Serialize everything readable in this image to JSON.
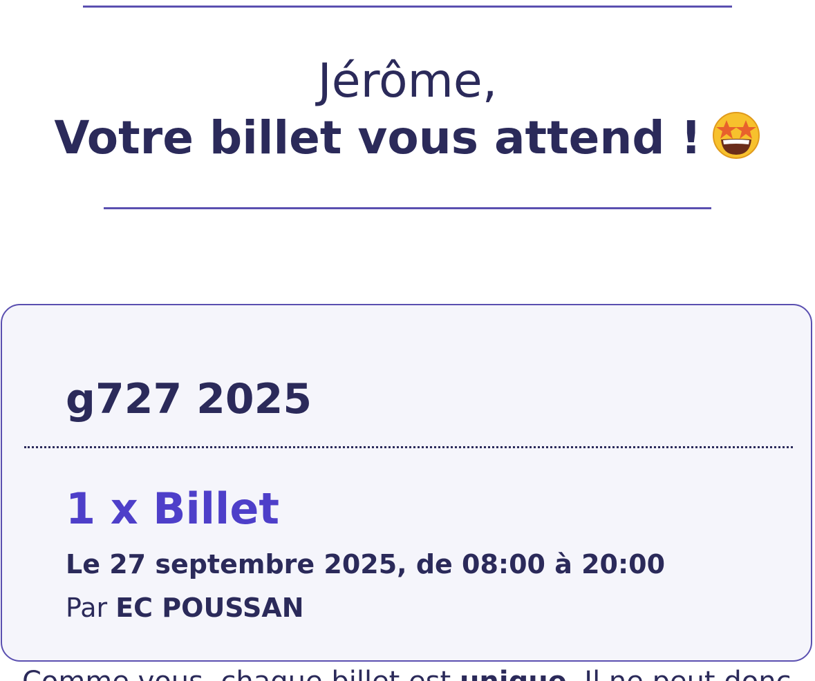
{
  "header": {
    "greeting": "Jérôme,",
    "headline": "Votre billet vous attend !",
    "emoji_icon": "star-struck-emoji"
  },
  "ticket": {
    "event_name": "g727 2025",
    "quantity_label": "1 x Billet",
    "date_line": "Le 27 septembre 2025, de 08:00 à 20:00",
    "organizer_prefix": "Par",
    "organizer_name": "EC POUSSAN"
  },
  "footer_text": {
    "part1": "Comme vous, chaque billet est ",
    "bold": "unique",
    "part2": ". Il ne peut donc"
  },
  "colors": {
    "primary_text": "#2b2a5a",
    "accent": "#4e3fc9",
    "border": "#5a4fb0",
    "card_bg": "#f5f5fb"
  }
}
